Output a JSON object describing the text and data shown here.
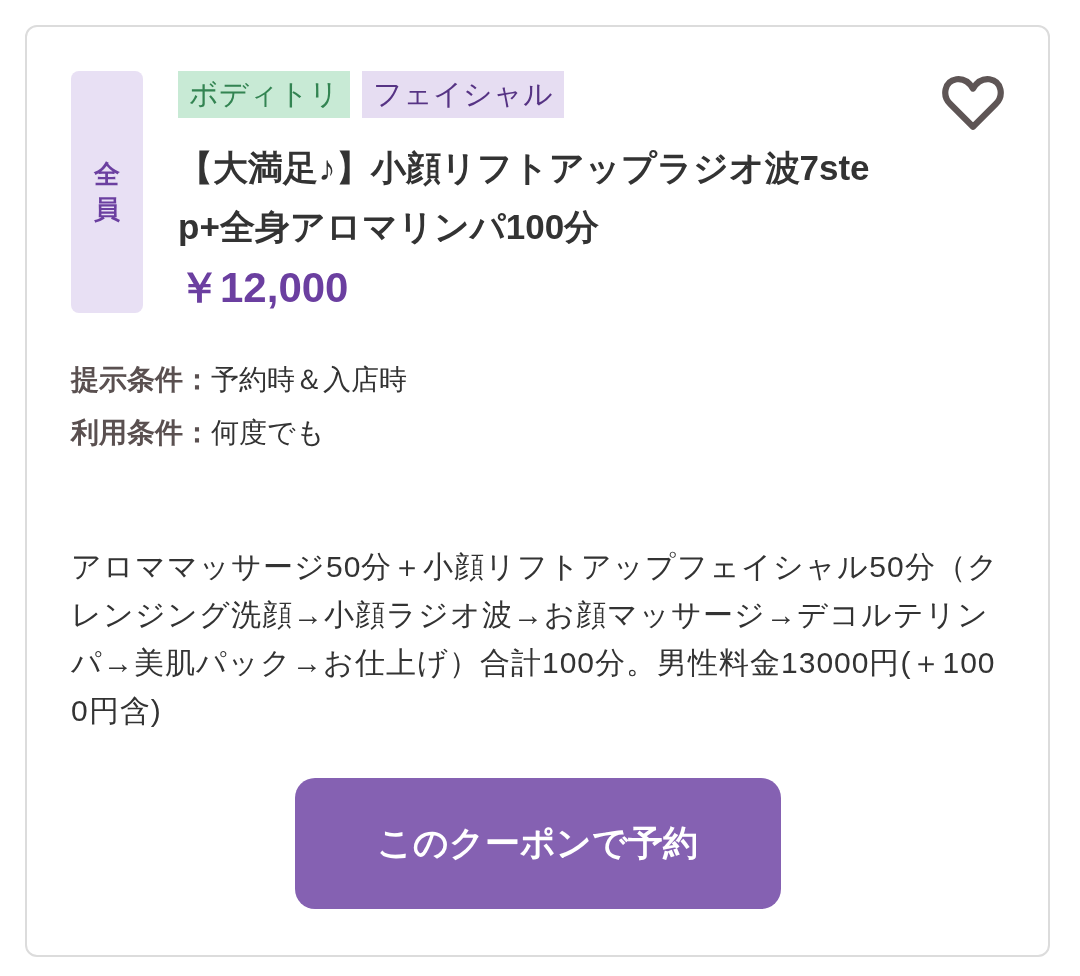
{
  "coupon": {
    "audience_badge": "全員",
    "tags": [
      {
        "label": "ボディトリ",
        "color": "#c8ead5"
      },
      {
        "label": "フェイシャル",
        "color": "#e6ddf2"
      }
    ],
    "favorite": false,
    "title": "【大満足♪】小顔リフトアップラジオ波7step+全身アロマリンパ100分",
    "price": "￥12,000",
    "conditions": [
      {
        "label": "提示条件：",
        "value": "予約時＆入店時"
      },
      {
        "label": "利用条件：",
        "value": "何度でも"
      }
    ],
    "description": "アロママッサージ50分＋小顔リフトアップフェイシャル50分（クレンジング洗顔→小顔ラジオ波→お顔マッサージ→デコルテリンパ→美肌パック→お仕上げ）合計100分。男性料金13000円(＋1000円含)",
    "reserve_button": "このクーポンで予約"
  }
}
